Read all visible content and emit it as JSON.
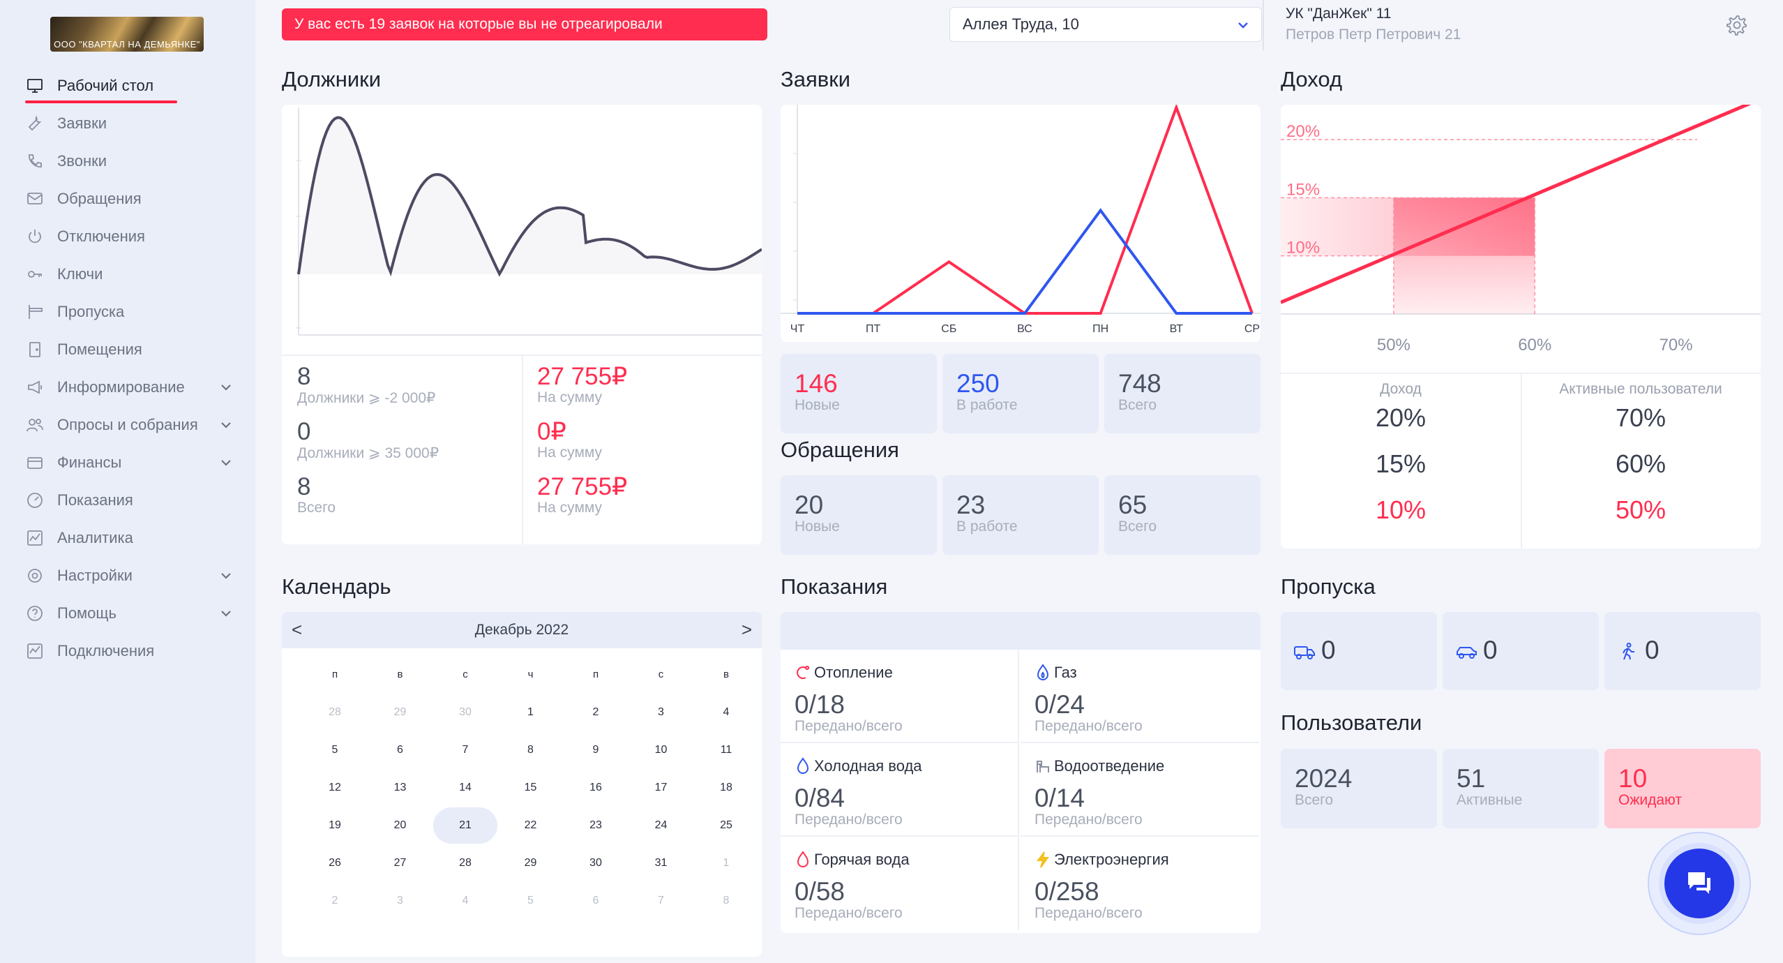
{
  "sidebar": {
    "logo_text": "ООО \"КВАРТАЛ НА ДЕМЬЯНКЕ\"",
    "items": [
      {
        "label": "Рабочий стол",
        "icon": "desktop-icon",
        "active": true
      },
      {
        "label": "Заявки",
        "icon": "wrench-icon"
      },
      {
        "label": "Звонки",
        "icon": "phone-icon"
      },
      {
        "label": "Обращения",
        "icon": "mail-icon"
      },
      {
        "label": "Отключения",
        "icon": "power-icon"
      },
      {
        "label": "Ключи",
        "icon": "key-icon"
      },
      {
        "label": "Пропуска",
        "icon": "barrier-icon"
      },
      {
        "label": "Помещения",
        "icon": "door-icon"
      },
      {
        "label": "Информирование",
        "icon": "megaphone-icon",
        "expandable": true
      },
      {
        "label": "Опросы и собрания",
        "icon": "users-icon",
        "expandable": true
      },
      {
        "label": "Финансы",
        "icon": "wallet-icon",
        "expandable": true
      },
      {
        "label": "Показания",
        "icon": "gauge-icon"
      },
      {
        "label": "Аналитика",
        "icon": "analytics-icon"
      },
      {
        "label": "Настройки",
        "icon": "settings-icon",
        "expandable": true
      },
      {
        "label": "Помощь",
        "icon": "help-icon",
        "expandable": true
      },
      {
        "label": "Подключения",
        "icon": "connections-icon"
      }
    ]
  },
  "topbar": {
    "alert": "У вас есть 19 заявок на которые вы не отреагировали",
    "address": "Аллея Труда, 10",
    "company": "УК \"ДанЖек\" 11",
    "person": "Петров Петр Петрович 21"
  },
  "debtors": {
    "title": "Должники",
    "rows": [
      {
        "count": "8",
        "count_label": "Должники ⩾ -2 000₽",
        "sum": "27 755₽",
        "sum_label": "На сумму"
      },
      {
        "count": "0",
        "count_label": "Должники ⩾ 35 000₽",
        "sum": "0₽",
        "sum_label": "На сумму"
      },
      {
        "count": "8",
        "count_label": "Всего",
        "sum": "27 755₽",
        "sum_label": "На сумму"
      }
    ]
  },
  "requests": {
    "title": "Заявки",
    "tiles": [
      {
        "value": "146",
        "label": "Новые"
      },
      {
        "value": "250",
        "label": "В работе"
      },
      {
        "value": "748",
        "label": "Всего"
      }
    ]
  },
  "appeals": {
    "title": "Обращения",
    "tiles": [
      {
        "value": "20",
        "label": "Новые"
      },
      {
        "value": "23",
        "label": "В работе"
      },
      {
        "value": "65",
        "label": "Всего"
      }
    ]
  },
  "income": {
    "title": "Доход",
    "col1_head": "Доход",
    "col2_head": "Активные пользователи",
    "col1": [
      "20%",
      "15%",
      "10%"
    ],
    "col2": [
      "70%",
      "60%",
      "50%"
    ]
  },
  "calendar": {
    "title": "Календарь",
    "month": "Декабрь 2022",
    "prev": "<",
    "next": ">",
    "weekdays": [
      "п",
      "в",
      "с",
      "ч",
      "п",
      "с",
      "в"
    ],
    "weeks": [
      [
        "28",
        "29",
        "30",
        "1",
        "2",
        "3",
        "4"
      ],
      [
        "5",
        "6",
        "7",
        "8",
        "9",
        "10",
        "11"
      ],
      [
        "12",
        "13",
        "14",
        "15",
        "16",
        "17",
        "18"
      ],
      [
        "19",
        "20",
        "21",
        "22",
        "23",
        "24",
        "25"
      ],
      [
        "26",
        "27",
        "28",
        "29",
        "30",
        "31",
        "1"
      ],
      [
        "2",
        "3",
        "4",
        "5",
        "6",
        "7",
        "8"
      ]
    ],
    "today": "21"
  },
  "readings": {
    "title": "Показания",
    "items": [
      {
        "name": "Отопление",
        "value": "0/18",
        "label": "Передано/всего",
        "icon": "heating-icon",
        "color": "#ff2d4f"
      },
      {
        "name": "Газ",
        "value": "0/24",
        "label": "Передано/всего",
        "icon": "gas-icon",
        "color": "#2f56f0"
      },
      {
        "name": "Холодная вода",
        "value": "0/84",
        "label": "Передано/всего",
        "icon": "cold-water-icon",
        "color": "#2f56f0"
      },
      {
        "name": "Водоотведение",
        "value": "0/14",
        "label": "Передано/всего",
        "icon": "drain-icon",
        "color": "#8a91a2"
      },
      {
        "name": "Горячая вода",
        "value": "0/58",
        "label": "Передано/всего",
        "icon": "hot-water-icon",
        "color": "#ff2d4f"
      },
      {
        "name": "Электроэнергия",
        "value": "0/258",
        "label": "Передано/всего",
        "icon": "lightning-icon",
        "color": "#f4c020"
      }
    ]
  },
  "passes": {
    "title": "Пропуска",
    "items": [
      {
        "value": "0",
        "icon": "truck-icon"
      },
      {
        "value": "0",
        "icon": "car-icon"
      },
      {
        "value": "0",
        "icon": "pedestrian-icon"
      }
    ]
  },
  "users": {
    "title": "Пользователи",
    "tiles": [
      {
        "value": "2024",
        "label": "Всего"
      },
      {
        "value": "51",
        "label": "Активные"
      },
      {
        "value": "10",
        "label": "Ожидают"
      }
    ]
  },
  "chart_data": [
    {
      "type": "line",
      "title": "",
      "series": [
        {
          "color": "#4d4b63"
        }
      ],
      "grid": false,
      "note_values": "unlabeled smooth oscillating curve"
    },
    {
      "type": "line",
      "categories": [
        "ЧТ",
        "ПТ",
        "СБ",
        "ВС",
        "ПН",
        "ВТ",
        "СР"
      ],
      "series": [
        {
          "values": [
            0,
            0,
            1,
            0,
            0,
            4,
            0
          ],
          "color": "#ff2d4f"
        },
        {
          "values": [
            0,
            0,
            0,
            0,
            2,
            0,
            0
          ],
          "color": "#2f56f0"
        }
      ],
      "ylim": [
        0,
        4
      ]
    },
    {
      "type": "line",
      "x_ticks": [
        "50%",
        "60%",
        "70%"
      ],
      "y_ticks": [
        "10%",
        "15%",
        "20%"
      ],
      "series": [
        {
          "x": [
            42,
            76
          ],
          "y": [
            6,
            23.5
          ],
          "color": "#ff2d4f"
        }
      ],
      "xlim": [
        42,
        76
      ],
      "ylim": [
        5,
        23
      ],
      "highlight_x": [
        50,
        60
      ],
      "highlight_y": [
        10,
        15
      ]
    }
  ]
}
